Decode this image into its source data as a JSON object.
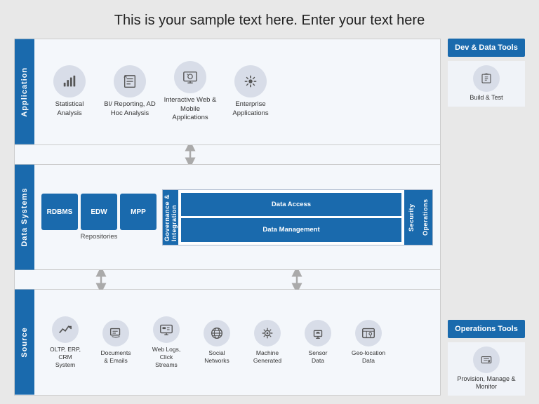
{
  "title": "This is your sample text here. Enter your text here",
  "rows": {
    "application": {
      "label": "Application",
      "items": [
        {
          "icon": "chart-bar",
          "label": "Statistical Analysis"
        },
        {
          "icon": "clipboard",
          "label": "BI/ Reporting, AD Hoc Analysis"
        },
        {
          "icon": "monitor-play",
          "label": "Interactive Web & Mobile Applications"
        },
        {
          "icon": "asterisk",
          "label": "Enterprise Applications"
        }
      ]
    },
    "datasystems": {
      "label": "Data Systems",
      "repos": {
        "boxes": [
          "RDBMS",
          "EDW",
          "MPP"
        ],
        "label": "Repositories"
      },
      "governance": {
        "left_label": "Governance & Integration",
        "center_top": "Data Access",
        "center_bottom": "Data Management",
        "right_labels": [
          "Security",
          "Operations"
        ]
      }
    },
    "source": {
      "label": "Source",
      "items": [
        {
          "icon": "trend-up",
          "label": "OLTP, ERP, CRM System"
        },
        {
          "icon": "mail",
          "label": "Documents & Emails"
        },
        {
          "icon": "monitor",
          "label": "Web Logs, Click Streams"
        },
        {
          "icon": "globe",
          "label": "Social Networks"
        },
        {
          "icon": "gear",
          "label": "Machine Generated"
        },
        {
          "icon": "screen",
          "label": "Sensor Data"
        },
        {
          "icon": "map-pin",
          "label": "Geo-location Data"
        }
      ]
    }
  },
  "right_panel": {
    "dev_tools_label": "Dev & Data Tools",
    "build_test_label": "Build & Test",
    "ops_tools_label": "Operations Tools",
    "provision_label": "Provision, Manage & Monitor"
  }
}
